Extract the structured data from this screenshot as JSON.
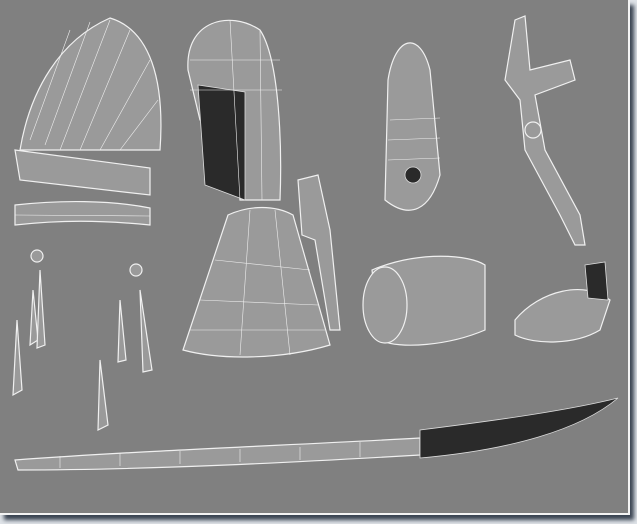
{
  "colors": {
    "background": "#808080",
    "mesh": "#9a9a9a",
    "wire": "#f0f0f0",
    "shadow": "#3a4452"
  }
}
